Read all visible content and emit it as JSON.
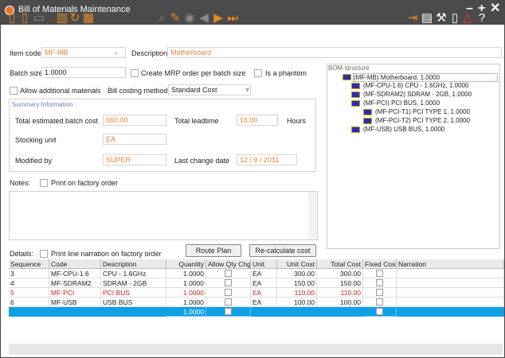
{
  "window": {
    "title": "Bill of Materials Maintenance"
  },
  "toolbar": {
    "left": [
      "new-doc-icon",
      "open-doc-icon",
      "save-icon",
      "delete-icon",
      "refresh-icon",
      "grid-icon"
    ],
    "nav": [
      "search-icon",
      "edit-brush-icon",
      "first-record-icon",
      "previous-record-icon",
      "next-record-icon",
      "last-record-icon"
    ],
    "right": [
      "export-icon",
      "print-icon",
      "tools-icon",
      "book-icon",
      "warning-icon",
      "help-icon"
    ],
    "accent": "#e48a1e"
  },
  "header": {
    "item_code_label": "Item code",
    "item_code": "MF-MB",
    "description_label": "Description",
    "description": "Motherboard",
    "batch_size_label": "Batch size",
    "batch_size": "1.0000",
    "create_mrp_label": "Create MRP order per batch size",
    "is_phantom_label": "Is a phantom",
    "allow_additional_label": "Allow additional materials",
    "costing_method_label": "Bill costing method",
    "costing_method": "Standard Cost"
  },
  "summary": {
    "title": "Summary Information",
    "total_batch_cost_label": "Total estimated batch cost",
    "total_batch_cost": "660.00",
    "total_leadtime_label": "Total leadtime",
    "total_leadtime": "16.00",
    "hours_label": "Hours",
    "stocking_unit_label": "Stocking unit",
    "stocking_unit": "EA",
    "modified_by_label": "Modified by",
    "modified_by": "SUPER",
    "last_change_label": "Last change date",
    "last_change_date": "12 / 9 / 2011"
  },
  "bom": {
    "title": "BOM structure",
    "nodes": [
      "(MF-MB) Motherboard, 1.0000",
      "(MF-CPU-1.6) CPU - 1.6GHz, 1.0000",
      "(MF-SDRAM2) SDRAM - 2GB, 1.0000",
      "(MF-PCI) PCI BUS, 1.0000",
      "(MF-PCI-T1) PCI TYPE 1, 1.0000",
      "(MF-PCI-T2) PCI TYPE 2, 1.0000",
      "(MF-USB) USB BUS, 1.0000"
    ]
  },
  "notes": {
    "label": "Notes:",
    "print_label": "Print on factory order"
  },
  "details": {
    "label": "Details:",
    "print_narration_label": "Print line narration on factory order",
    "route_plan": "Route Plan",
    "recalc": "Re-calculate cost"
  },
  "grid": {
    "columns": [
      "Sequence",
      "Code",
      "Description",
      "Quantity",
      "Allow Qty Chg",
      "Unit",
      "Unit Cost",
      "Total Cost",
      "Fixed Cost",
      "Narration"
    ],
    "rows": [
      {
        "seq": "3",
        "code": "MF-CPU-1.6",
        "desc": "CPU - 1.6GHz",
        "qty": "1.0000",
        "unit": "EA",
        "unit_cost": "300.00",
        "total": "300.00",
        "color": "#222"
      },
      {
        "seq": "4",
        "code": "MF-SDRAM2",
        "desc": "SDRAM - 2GB",
        "qty": "1.0000",
        "unit": "EA",
        "unit_cost": "150.00",
        "total": "150.00",
        "color": "#222"
      },
      {
        "seq": "5",
        "code": "MF-PCI",
        "desc": "PCI BUS",
        "qty": "1.0000",
        "unit": "EA",
        "unit_cost": "110.00",
        "total": "110.00",
        "color": "#d21f1f"
      },
      {
        "seq": "6",
        "code": "MF-USB",
        "desc": "USB BUS",
        "qty": "1.0000",
        "unit": "EA",
        "unit_cost": "100.00",
        "total": "100.00",
        "color": "#222"
      }
    ],
    "new_row_qty": "1.0000",
    "selection_color": "#0fa0e6"
  }
}
